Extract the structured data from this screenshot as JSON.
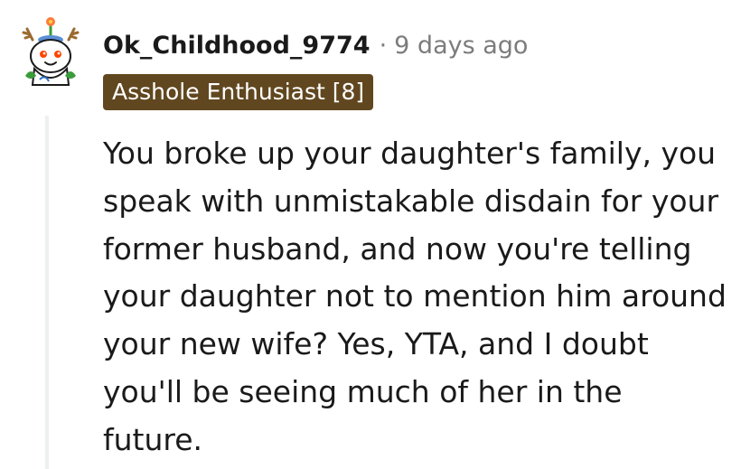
{
  "comment": {
    "author": "Ok_Childhood_9774",
    "separator": "·",
    "timestamp": "9 days ago",
    "flair": "Asshole Enthusiast [8]",
    "text": "You broke up your daughter's family, you speak with unmistakable disdain for your former husband, and now you're telling your daughter not to mention him around your new wife? Yes, YTA, and I doubt you'll be seeing much of her in the future.",
    "avatar_icon": "snoo-avatar-icon"
  },
  "colors": {
    "flair_background": "#61471f",
    "flair_text": "#ffffff",
    "meta_text": "#7c7c7c",
    "body_text": "#1a1a1b",
    "thread_line": "#edeff1"
  }
}
